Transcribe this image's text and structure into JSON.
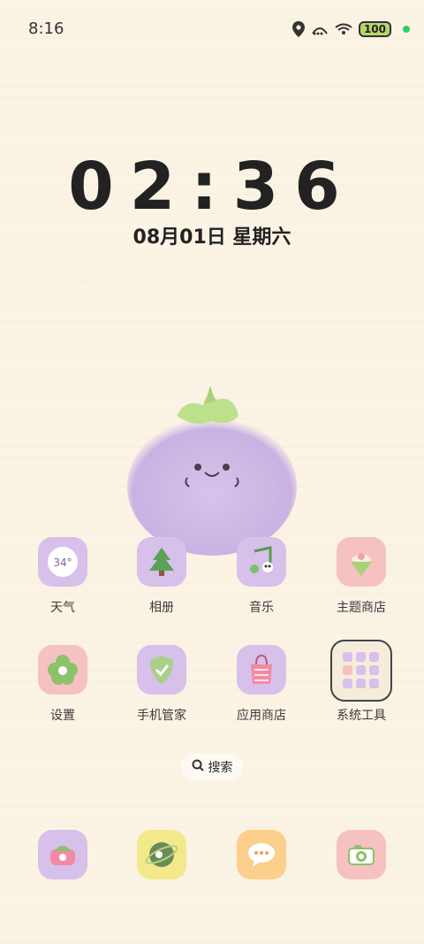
{
  "status": {
    "time": "8:16",
    "battery": "100"
  },
  "lock": {
    "clock": "02:36",
    "date": "08月01日 星期六"
  },
  "apps": {
    "weather": {
      "label": "天气",
      "temp": "34°"
    },
    "photos": {
      "label": "相册"
    },
    "music": {
      "label": "音乐"
    },
    "theme_store": {
      "label": "主题商店"
    },
    "settings": {
      "label": "设置"
    },
    "phone_manager": {
      "label": "手机管家"
    },
    "app_store": {
      "label": "应用商店"
    },
    "system_tools": {
      "label": "系统工具"
    }
  },
  "search": {
    "label": "搜索"
  },
  "dock": [
    "phone-icon",
    "browser-icon",
    "messages-icon",
    "camera-icon"
  ]
}
